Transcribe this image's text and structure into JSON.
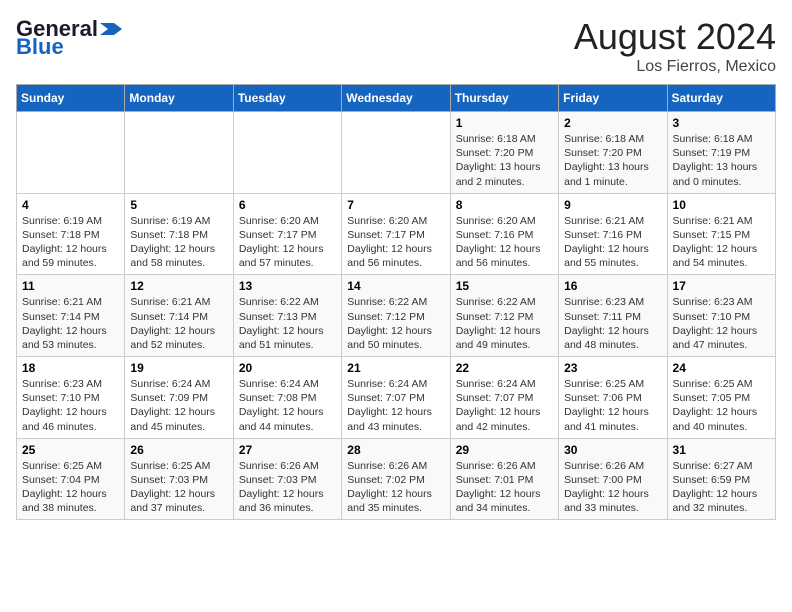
{
  "header": {
    "logo_general": "General",
    "logo_blue": "Blue",
    "title": "August 2024",
    "subtitle": "Los Fierros, Mexico"
  },
  "days_of_week": [
    "Sunday",
    "Monday",
    "Tuesday",
    "Wednesday",
    "Thursday",
    "Friday",
    "Saturday"
  ],
  "weeks": [
    [
      {
        "day": "",
        "info": ""
      },
      {
        "day": "",
        "info": ""
      },
      {
        "day": "",
        "info": ""
      },
      {
        "day": "",
        "info": ""
      },
      {
        "day": "1",
        "info": "Sunrise: 6:18 AM\nSunset: 7:20 PM\nDaylight: 13 hours\nand 2 minutes."
      },
      {
        "day": "2",
        "info": "Sunrise: 6:18 AM\nSunset: 7:20 PM\nDaylight: 13 hours\nand 1 minute."
      },
      {
        "day": "3",
        "info": "Sunrise: 6:18 AM\nSunset: 7:19 PM\nDaylight: 13 hours\nand 0 minutes."
      }
    ],
    [
      {
        "day": "4",
        "info": "Sunrise: 6:19 AM\nSunset: 7:18 PM\nDaylight: 12 hours\nand 59 minutes."
      },
      {
        "day": "5",
        "info": "Sunrise: 6:19 AM\nSunset: 7:18 PM\nDaylight: 12 hours\nand 58 minutes."
      },
      {
        "day": "6",
        "info": "Sunrise: 6:20 AM\nSunset: 7:17 PM\nDaylight: 12 hours\nand 57 minutes."
      },
      {
        "day": "7",
        "info": "Sunrise: 6:20 AM\nSunset: 7:17 PM\nDaylight: 12 hours\nand 56 minutes."
      },
      {
        "day": "8",
        "info": "Sunrise: 6:20 AM\nSunset: 7:16 PM\nDaylight: 12 hours\nand 56 minutes."
      },
      {
        "day": "9",
        "info": "Sunrise: 6:21 AM\nSunset: 7:16 PM\nDaylight: 12 hours\nand 55 minutes."
      },
      {
        "day": "10",
        "info": "Sunrise: 6:21 AM\nSunset: 7:15 PM\nDaylight: 12 hours\nand 54 minutes."
      }
    ],
    [
      {
        "day": "11",
        "info": "Sunrise: 6:21 AM\nSunset: 7:14 PM\nDaylight: 12 hours\nand 53 minutes."
      },
      {
        "day": "12",
        "info": "Sunrise: 6:21 AM\nSunset: 7:14 PM\nDaylight: 12 hours\nand 52 minutes."
      },
      {
        "day": "13",
        "info": "Sunrise: 6:22 AM\nSunset: 7:13 PM\nDaylight: 12 hours\nand 51 minutes."
      },
      {
        "day": "14",
        "info": "Sunrise: 6:22 AM\nSunset: 7:12 PM\nDaylight: 12 hours\nand 50 minutes."
      },
      {
        "day": "15",
        "info": "Sunrise: 6:22 AM\nSunset: 7:12 PM\nDaylight: 12 hours\nand 49 minutes."
      },
      {
        "day": "16",
        "info": "Sunrise: 6:23 AM\nSunset: 7:11 PM\nDaylight: 12 hours\nand 48 minutes."
      },
      {
        "day": "17",
        "info": "Sunrise: 6:23 AM\nSunset: 7:10 PM\nDaylight: 12 hours\nand 47 minutes."
      }
    ],
    [
      {
        "day": "18",
        "info": "Sunrise: 6:23 AM\nSunset: 7:10 PM\nDaylight: 12 hours\nand 46 minutes."
      },
      {
        "day": "19",
        "info": "Sunrise: 6:24 AM\nSunset: 7:09 PM\nDaylight: 12 hours\nand 45 minutes."
      },
      {
        "day": "20",
        "info": "Sunrise: 6:24 AM\nSunset: 7:08 PM\nDaylight: 12 hours\nand 44 minutes."
      },
      {
        "day": "21",
        "info": "Sunrise: 6:24 AM\nSunset: 7:07 PM\nDaylight: 12 hours\nand 43 minutes."
      },
      {
        "day": "22",
        "info": "Sunrise: 6:24 AM\nSunset: 7:07 PM\nDaylight: 12 hours\nand 42 minutes."
      },
      {
        "day": "23",
        "info": "Sunrise: 6:25 AM\nSunset: 7:06 PM\nDaylight: 12 hours\nand 41 minutes."
      },
      {
        "day": "24",
        "info": "Sunrise: 6:25 AM\nSunset: 7:05 PM\nDaylight: 12 hours\nand 40 minutes."
      }
    ],
    [
      {
        "day": "25",
        "info": "Sunrise: 6:25 AM\nSunset: 7:04 PM\nDaylight: 12 hours\nand 38 minutes."
      },
      {
        "day": "26",
        "info": "Sunrise: 6:25 AM\nSunset: 7:03 PM\nDaylight: 12 hours\nand 37 minutes."
      },
      {
        "day": "27",
        "info": "Sunrise: 6:26 AM\nSunset: 7:03 PM\nDaylight: 12 hours\nand 36 minutes."
      },
      {
        "day": "28",
        "info": "Sunrise: 6:26 AM\nSunset: 7:02 PM\nDaylight: 12 hours\nand 35 minutes."
      },
      {
        "day": "29",
        "info": "Sunrise: 6:26 AM\nSunset: 7:01 PM\nDaylight: 12 hours\nand 34 minutes."
      },
      {
        "day": "30",
        "info": "Sunrise: 6:26 AM\nSunset: 7:00 PM\nDaylight: 12 hours\nand 33 minutes."
      },
      {
        "day": "31",
        "info": "Sunrise: 6:27 AM\nSunset: 6:59 PM\nDaylight: 12 hours\nand 32 minutes."
      }
    ]
  ]
}
